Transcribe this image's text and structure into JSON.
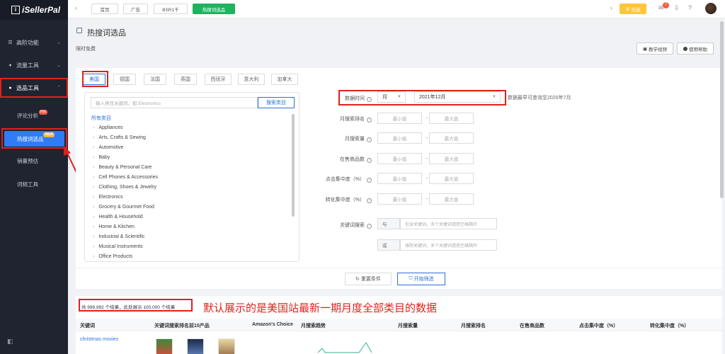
{
  "app": {
    "name": "iSellerPal"
  },
  "sidebar": {
    "items": [
      {
        "label": "高阶功能",
        "icon": "menu-icon"
      },
      {
        "label": "流量工具",
        "icon": "traffic-icon"
      },
      {
        "label": "选品工具",
        "icon": "product-icon"
      }
    ],
    "sub": [
      {
        "label": "评论分析",
        "badge": "Hot"
      },
      {
        "label": "热搜词选品",
        "badge": "NEW"
      },
      {
        "label": "销量预估"
      },
      {
        "label": "词频工具"
      }
    ]
  },
  "topbar": {
    "tabs": [
      "首页",
      "广告",
      "BSR1千",
      "热搜词选品"
    ],
    "vip_label": "充值",
    "notif_count": "7"
  },
  "page": {
    "title": "热搜词选品",
    "subtitle": "限时免费",
    "video_btn": "教学视频",
    "help_btn": "使用帮助"
  },
  "countries": [
    "美国",
    "德国",
    "法国",
    "英国",
    "西班牙",
    "意大利",
    "加拿大"
  ],
  "category": {
    "search_placeholder": "输入类目关键词，如:Electronics",
    "search_btn": "搜索类目",
    "all_label": "所有类目",
    "items": [
      "Appliances",
      "Arts, Crafts & Sewing",
      "Automotive",
      "Baby",
      "Beauty & Personal Care",
      "Cell Phones & Accessories",
      "Clothing, Shoes & Jewelry",
      "Electronics",
      "Grocery & Gourmet Food",
      "Health & Household",
      "Home & Kitchen",
      "Industrial & Scientific",
      "Musical Instruments",
      "Office Products"
    ]
  },
  "filters": {
    "time_label": "数据时间",
    "period": "月",
    "month": "2021年12月",
    "time_hint": "数据最早可查询至2020年7月",
    "rows": [
      "月搜索排名",
      "月搜索量",
      "在售商品数",
      "点击集中度（%）",
      "转化集中度（%）"
    ],
    "min_placeholder": "最小值",
    "max_placeholder": "最大值",
    "kw_label": "关键词搜索",
    "kw_op1": "与",
    "kw_ph1": "包含关键词，多个关键词请用空格隔开",
    "kw_op2": "或",
    "kw_ph2": "排除关键词，多个关键词请用空格隔开",
    "reset_btn": "重置条件",
    "go_btn": "开始筛选"
  },
  "results": {
    "count_text": "共 999,992 个结果，此处展示 100,000 个结果",
    "annotation": "默认展示的是美国站最新一期月度全部类目的数据",
    "headers": [
      "关键词",
      "关键词搜索排名前10产品",
      "Amazon's Choice",
      "月搜索趋势",
      "月搜索量",
      "月搜索排名",
      "在售商品数",
      "点击集中度（%）",
      "转化集中度（%）"
    ],
    "first_keyword": "christmas movies"
  }
}
